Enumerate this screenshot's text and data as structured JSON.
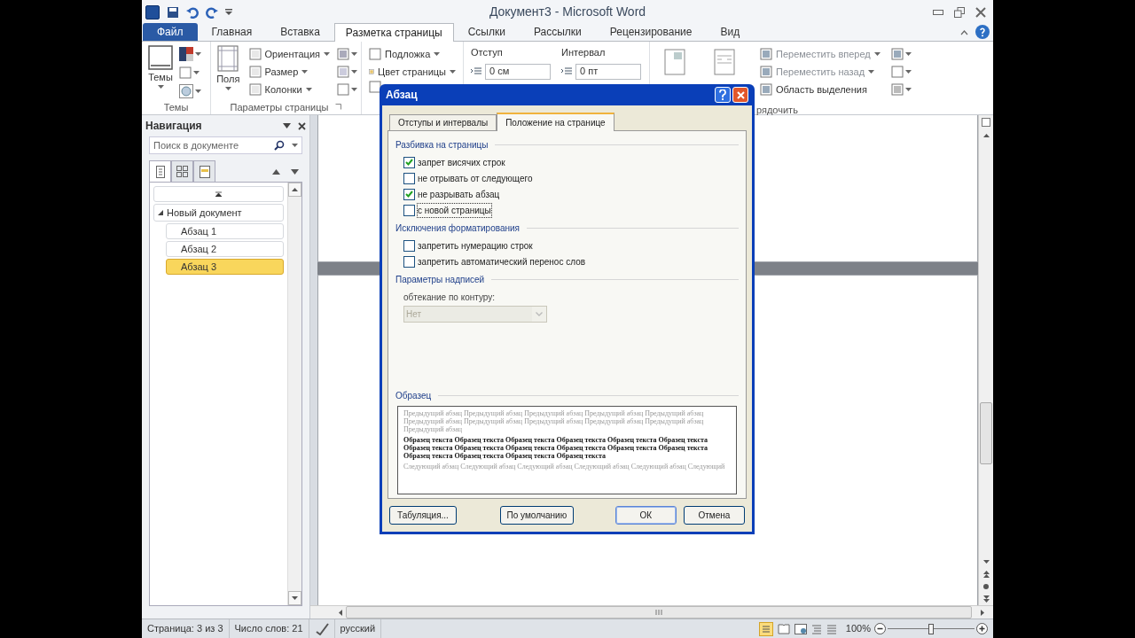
{
  "window": {
    "title": "Документ3 - Microsoft Word"
  },
  "ribbon_tabs": [
    {
      "label": "Файл",
      "kind": "file",
      "selected": false
    },
    {
      "label": "Главная",
      "kind": "tab",
      "selected": false
    },
    {
      "label": "Вставка",
      "kind": "tab",
      "selected": false
    },
    {
      "label": "Разметка страницы",
      "kind": "tab",
      "selected": true
    },
    {
      "label": "Ссылки",
      "kind": "tab",
      "selected": false
    },
    {
      "label": "Рассылки",
      "kind": "tab",
      "selected": false
    },
    {
      "label": "Рецензирование",
      "kind": "tab",
      "selected": false
    },
    {
      "label": "Вид",
      "kind": "tab",
      "selected": false
    }
  ],
  "ribbon": {
    "themes": {
      "button": "Темы",
      "group_label": "Темы"
    },
    "page_setup": {
      "button": "Поля",
      "commands": [
        "Ориентация",
        "Размер",
        "Колонки"
      ],
      "group_label": "Параметры страницы"
    },
    "background": {
      "commands": [
        "Подложка",
        "Цвет страницы"
      ]
    },
    "paragraph": {
      "indent_label": "Отступ",
      "indent_value": "0 см",
      "spacing_label": "Интервал",
      "spacing_value": "0 пт"
    },
    "arrange": {
      "commands": [
        "Переместить вперед",
        "Переместить назад",
        "Область выделения"
      ],
      "group_label": "рядочить"
    }
  },
  "navigation": {
    "title": "Навигация",
    "search": {
      "placeholder": "Поиск в документе"
    },
    "view_tabs": [
      {
        "kind": "headings",
        "selected": true
      },
      {
        "kind": "pages",
        "selected": false
      },
      {
        "kind": "results",
        "selected": false
      }
    ],
    "tree": [
      {
        "label": "Новый документ",
        "expanded": true,
        "selected": false,
        "children": [
          {
            "label": "Абзац 1",
            "selected": false
          },
          {
            "label": "Абзац 2",
            "selected": false
          },
          {
            "label": "Абзац 3",
            "selected": true
          }
        ]
      }
    ]
  },
  "dialog": {
    "title": "Абзац",
    "tabs": [
      {
        "label": "Отступы и интервалы",
        "selected": false
      },
      {
        "label": "Положение на странице",
        "selected": true
      }
    ],
    "sections": [
      {
        "title": "Разбивка на страницы",
        "items": [
          {
            "label": "запрет висячих строк",
            "checked": true,
            "focused": false
          },
          {
            "label": "не отрывать от следующего",
            "checked": false,
            "focused": false
          },
          {
            "label": "не разрывать абзац",
            "checked": true,
            "focused": false
          },
          {
            "label": "с новой страницы",
            "checked": false,
            "focused": true
          }
        ]
      },
      {
        "title": "Исключения форматирования",
        "items": [
          {
            "label": "запретить нумерацию строк",
            "checked": false,
            "focused": false
          },
          {
            "label": "запретить автоматический перенос слов",
            "checked": false,
            "focused": false
          }
        ]
      }
    ],
    "textbox": {
      "title": "Параметры надписей",
      "label": "обтекание по контуру:",
      "value": "Нет",
      "disabled": true
    },
    "preview": {
      "title": "Образец",
      "previous": "Предыдущий абзац Предыдущий абзац Предыдущий абзац Предыдущий абзац Предыдущий абзац Предыдущий абзац Предыдущий абзац Предыдущий абзац Предыдущий абзац Предыдущий абзац Предыдущий абзац",
      "sample": "Образец текста Образец текста Образец текста Образец текста Образец текста Образец текста Образец текста Образец текста Образец текста Образец текста Образец текста Образец текста Образец текста Образец текста Образец текста Образец текста",
      "next": "Следующий абзац Следующий абзац Следующий абзац Следующий абзац Следующий абзац Следующий"
    },
    "buttons": [
      {
        "label": "Табуляция...",
        "default": false
      },
      {
        "label": "По умолчанию",
        "default": false
      },
      {
        "label": "ОК",
        "default": true
      },
      {
        "label": "Отмена",
        "default": false
      }
    ]
  },
  "status_bar": {
    "page": "Страница: 3 из 3",
    "words": "Число слов: 21",
    "language": "русский",
    "zoom": "100%",
    "zoom_slider": {
      "level": 0.5
    }
  }
}
